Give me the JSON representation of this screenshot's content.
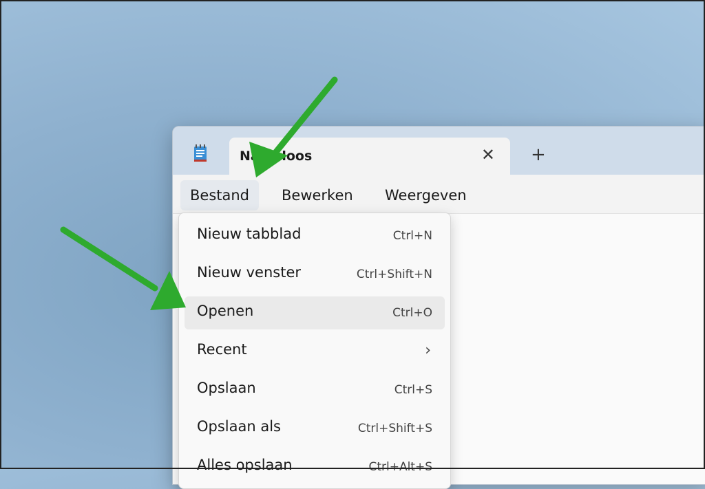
{
  "tab": {
    "title": "Naamloos",
    "close_glyph": "✕",
    "new_tab_glyph": "+"
  },
  "menubar": {
    "items": [
      {
        "label": "Bestand"
      },
      {
        "label": "Bewerken"
      },
      {
        "label": "Weergeven"
      }
    ]
  },
  "file_menu": {
    "items": [
      {
        "label": "Nieuw tabblad",
        "shortcut": "Ctrl+N"
      },
      {
        "label": "Nieuw venster",
        "shortcut": "Ctrl+Shift+N"
      },
      {
        "label": "Openen",
        "shortcut": "Ctrl+O"
      },
      {
        "label": "Recent",
        "chevron": "›"
      },
      {
        "label": "Opslaan",
        "shortcut": "Ctrl+S"
      },
      {
        "label": "Opslaan als",
        "shortcut": "Ctrl+Shift+S"
      },
      {
        "label": "Alles opslaan",
        "shortcut": "Ctrl+Alt+S"
      }
    ]
  },
  "colors": {
    "arrow": "#2eaa2e",
    "titlebar": "#cfdcea",
    "hover": "#eaeaea"
  },
  "icons": {
    "app": "notepad-icon"
  }
}
